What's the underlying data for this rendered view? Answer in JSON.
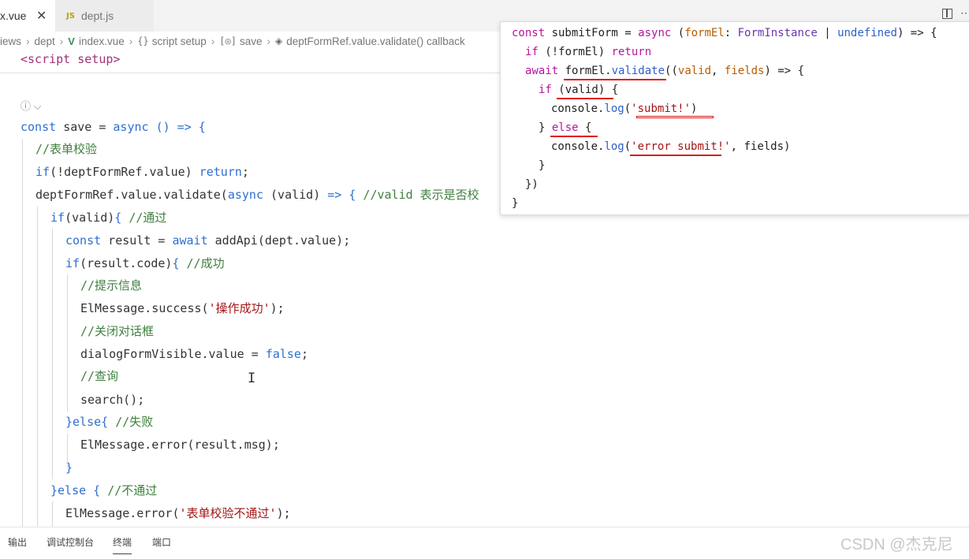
{
  "tabs": [
    {
      "label": "x.vue",
      "close": "✕"
    },
    {
      "icon": "JS",
      "label": "dept.js"
    }
  ],
  "breadcrumb": {
    "items": [
      "iews",
      "dept",
      "index.vue",
      "script setup",
      "save",
      "deptFormRef.value.validate() callback"
    ]
  },
  "code": {
    "lines": [
      [
        {
          "t": "<script setup>",
          "c": "tag"
        }
      ],
      [
        {
          "t": "const ",
          "c": "kw"
        },
        {
          "t": "save = ",
          "c": "plain"
        },
        {
          "t": "async",
          "c": "kw"
        },
        {
          "t": " () => {",
          "c": "kw"
        }
      ],
      [
        {
          "t": "//表单校验",
          "c": "cm"
        }
      ],
      [
        {
          "t": "if",
          "c": "kw"
        },
        {
          "t": "(!deptFormRef.value) ",
          "c": "plain"
        },
        {
          "t": "return",
          "c": "kw"
        },
        {
          "t": ";",
          "c": "plain"
        }
      ],
      [
        {
          "t": "deptFormRef.value.validate(",
          "c": "plain"
        },
        {
          "t": "async",
          "c": "kw"
        },
        {
          "t": " (valid) ",
          "c": "plain"
        },
        {
          "t": "=> {",
          "c": "kw"
        },
        {
          "t": " //valid 表示是否校",
          "c": "cm"
        }
      ],
      [
        {
          "t": "if",
          "c": "kw"
        },
        {
          "t": "(valid)",
          "c": "plain"
        },
        {
          "t": "{",
          "c": "kw"
        },
        {
          "t": " //通过",
          "c": "cm"
        }
      ],
      [
        {
          "t": "const",
          "c": "kw"
        },
        {
          "t": " result = ",
          "c": "plain"
        },
        {
          "t": "await",
          "c": "kw"
        },
        {
          "t": " addApi(dept.value);",
          "c": "plain"
        }
      ],
      [
        {
          "t": "if",
          "c": "kw"
        },
        {
          "t": "(result.code)",
          "c": "plain"
        },
        {
          "t": "{",
          "c": "kw"
        },
        {
          "t": " //成功",
          "c": "cm"
        }
      ],
      [
        {
          "t": "//提示信息",
          "c": "cm"
        }
      ],
      [
        {
          "t": "ElMessage.success(",
          "c": "plain"
        },
        {
          "t": "'操作成功'",
          "c": "str"
        },
        {
          "t": ");",
          "c": "plain"
        }
      ],
      [
        {
          "t": "//关闭对话框",
          "c": "cm"
        }
      ],
      [
        {
          "t": "dialogFormVisible.value = ",
          "c": "plain"
        },
        {
          "t": "false",
          "c": "kw"
        },
        {
          "t": ";",
          "c": "plain"
        }
      ],
      [
        {
          "t": "//查询",
          "c": "cm"
        }
      ],
      [
        {
          "t": "search();",
          "c": "plain"
        }
      ],
      [
        {
          "t": "}",
          "c": "kw"
        },
        {
          "t": "else",
          "c": "kw"
        },
        {
          "t": "{",
          "c": "kw"
        },
        {
          "t": " //失败",
          "c": "cm"
        }
      ],
      [
        {
          "t": "ElMessage.error(result.msg);",
          "c": "plain"
        }
      ],
      [
        {
          "t": "}",
          "c": "kw"
        }
      ],
      [
        {
          "t": "}",
          "c": "kw"
        },
        {
          "t": "else",
          "c": "kw"
        },
        {
          "t": " {",
          "c": "kw"
        },
        {
          "t": " //不通过",
          "c": "cm"
        }
      ],
      [
        {
          "t": "ElMessage.error(",
          "c": "plain"
        },
        {
          "t": "'表单校验不通过'",
          "c": "str"
        },
        {
          "t": ");",
          "c": "plain"
        }
      ]
    ]
  },
  "overlay": {
    "lines": [
      [
        {
          "t": "const ",
          "c": "ov-kw"
        },
        {
          "t": "submitForm",
          "c": "ov-plain"
        },
        {
          "t": " = ",
          "c": "ov-plain"
        },
        {
          "t": "async",
          "c": "ov-kw"
        },
        {
          "t": " (",
          "c": "ov-plain"
        },
        {
          "t": "formEl",
          "c": "ov-param"
        },
        {
          "t": ": ",
          "c": "ov-plain"
        },
        {
          "t": "FormInstance",
          "c": "ov-kw2"
        },
        {
          "t": " | ",
          "c": "ov-plain"
        },
        {
          "t": "undefined",
          "c": "ov-blue"
        },
        {
          "t": ") => {",
          "c": "ov-plain"
        }
      ],
      [
        {
          "t": "if",
          "c": "ov-kw"
        },
        {
          "t": " (!formEl) ",
          "c": "ov-plain"
        },
        {
          "t": "return",
          "c": "ov-kw"
        }
      ],
      [
        {
          "t": "await",
          "c": "ov-kw"
        },
        {
          "t": " formEl.",
          "c": "ov-plain"
        },
        {
          "t": "validate",
          "c": "ov-blue"
        },
        {
          "t": "((",
          "c": "ov-plain"
        },
        {
          "t": "valid",
          "c": "ov-param"
        },
        {
          "t": ", ",
          "c": "ov-plain"
        },
        {
          "t": "fields",
          "c": "ov-param"
        },
        {
          "t": ") => {",
          "c": "ov-plain"
        }
      ],
      [
        {
          "t": "if",
          "c": "ov-kw"
        },
        {
          "t": " (valid) {",
          "c": "ov-plain"
        }
      ],
      [
        {
          "t": "console.",
          "c": "ov-plain"
        },
        {
          "t": "log",
          "c": "ov-blue"
        },
        {
          "t": "(",
          "c": "ov-plain"
        },
        {
          "t": "'submit!'",
          "c": "ov-str"
        },
        {
          "t": ")",
          "c": "ov-plain"
        }
      ],
      [
        {
          "t": "} ",
          "c": "ov-plain"
        },
        {
          "t": "else",
          "c": "ov-kw"
        },
        {
          "t": " {",
          "c": "ov-plain"
        }
      ],
      [
        {
          "t": "console.",
          "c": "ov-plain"
        },
        {
          "t": "log",
          "c": "ov-blue"
        },
        {
          "t": "(",
          "c": "ov-plain"
        },
        {
          "t": "'error submit!'",
          "c": "ov-str"
        },
        {
          "t": ", fields)",
          "c": "ov-plain"
        }
      ],
      [
        {
          "t": "}",
          "c": "ov-plain"
        }
      ],
      [
        {
          "t": "})",
          "c": "ov-plain"
        }
      ],
      [
        {
          "t": "}",
          "c": "ov-plain"
        }
      ]
    ]
  },
  "panel": {
    "tabs": [
      "输出",
      "调试控制台",
      "终端",
      "端口"
    ],
    "active": "终端"
  },
  "watermark": "CSDN @杰克尼",
  "colors": {
    "underline": "#dd1111",
    "keyword": "#2f6fd0",
    "comment": "#3f7f3f"
  }
}
